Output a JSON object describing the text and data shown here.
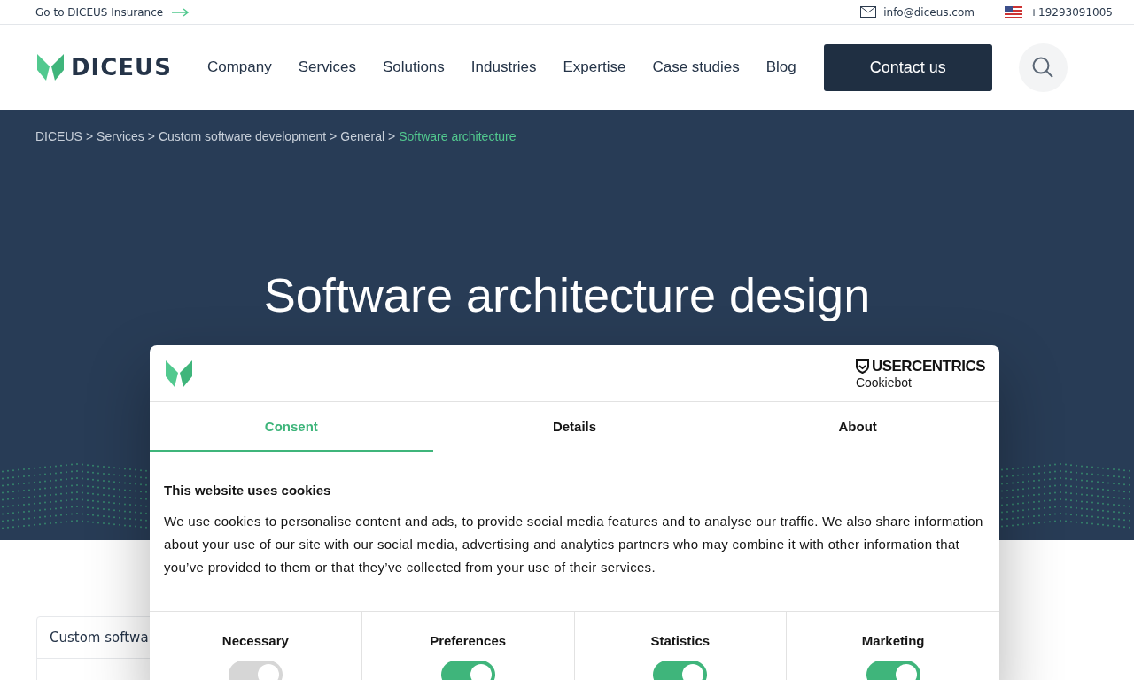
{
  "topbar": {
    "insurance_link": "Go to DICEUS Insurance",
    "email": "info@diceus.com",
    "phone": "+19293091005"
  },
  "header": {
    "logo": "DICEUS",
    "nav": [
      "Company",
      "Services",
      "Solutions",
      "Industries",
      "Expertise",
      "Case studies",
      "Blog"
    ],
    "cta": "Contact us"
  },
  "breadcrumbs": [
    {
      "label": "DICEUS",
      "current": false
    },
    {
      "separator": ">",
      "label": "Services",
      "current": false
    },
    {
      "separator": ">",
      "label": "Custom software development",
      "current": false
    },
    {
      "separator": ">",
      "label": "General",
      "current": false
    },
    {
      "separator": ">",
      "label": "Software architecture",
      "current": true
    }
  ],
  "hero": {
    "title": "Software architecture design"
  },
  "sidebar": {
    "items": [
      "Custom softwa"
    ]
  },
  "cookie_dialog": {
    "brand": "USERCENTRICS",
    "brand_sub": "Cookiebot",
    "tabs": [
      {
        "label": "Consent",
        "selected": true
      },
      {
        "label": "Details",
        "selected": false
      },
      {
        "label": "About",
        "selected": false
      }
    ],
    "heading": "This website uses cookies",
    "body": "We use cookies to personalise content and ads, to provide social media features and to analyse our traffic. We also share information about your use of our site with our social media, advertising and analytics partners who may combine it with other information that you’ve provided to them or that they’ve collected from your use of their services.",
    "categories": [
      {
        "label": "Necessary",
        "on": true,
        "disabled": true
      },
      {
        "label": "Preferences",
        "on": true,
        "disabled": false
      },
      {
        "label": "Statistics",
        "on": true,
        "disabled": false
      },
      {
        "label": "Marketing",
        "on": true,
        "disabled": false
      }
    ]
  }
}
